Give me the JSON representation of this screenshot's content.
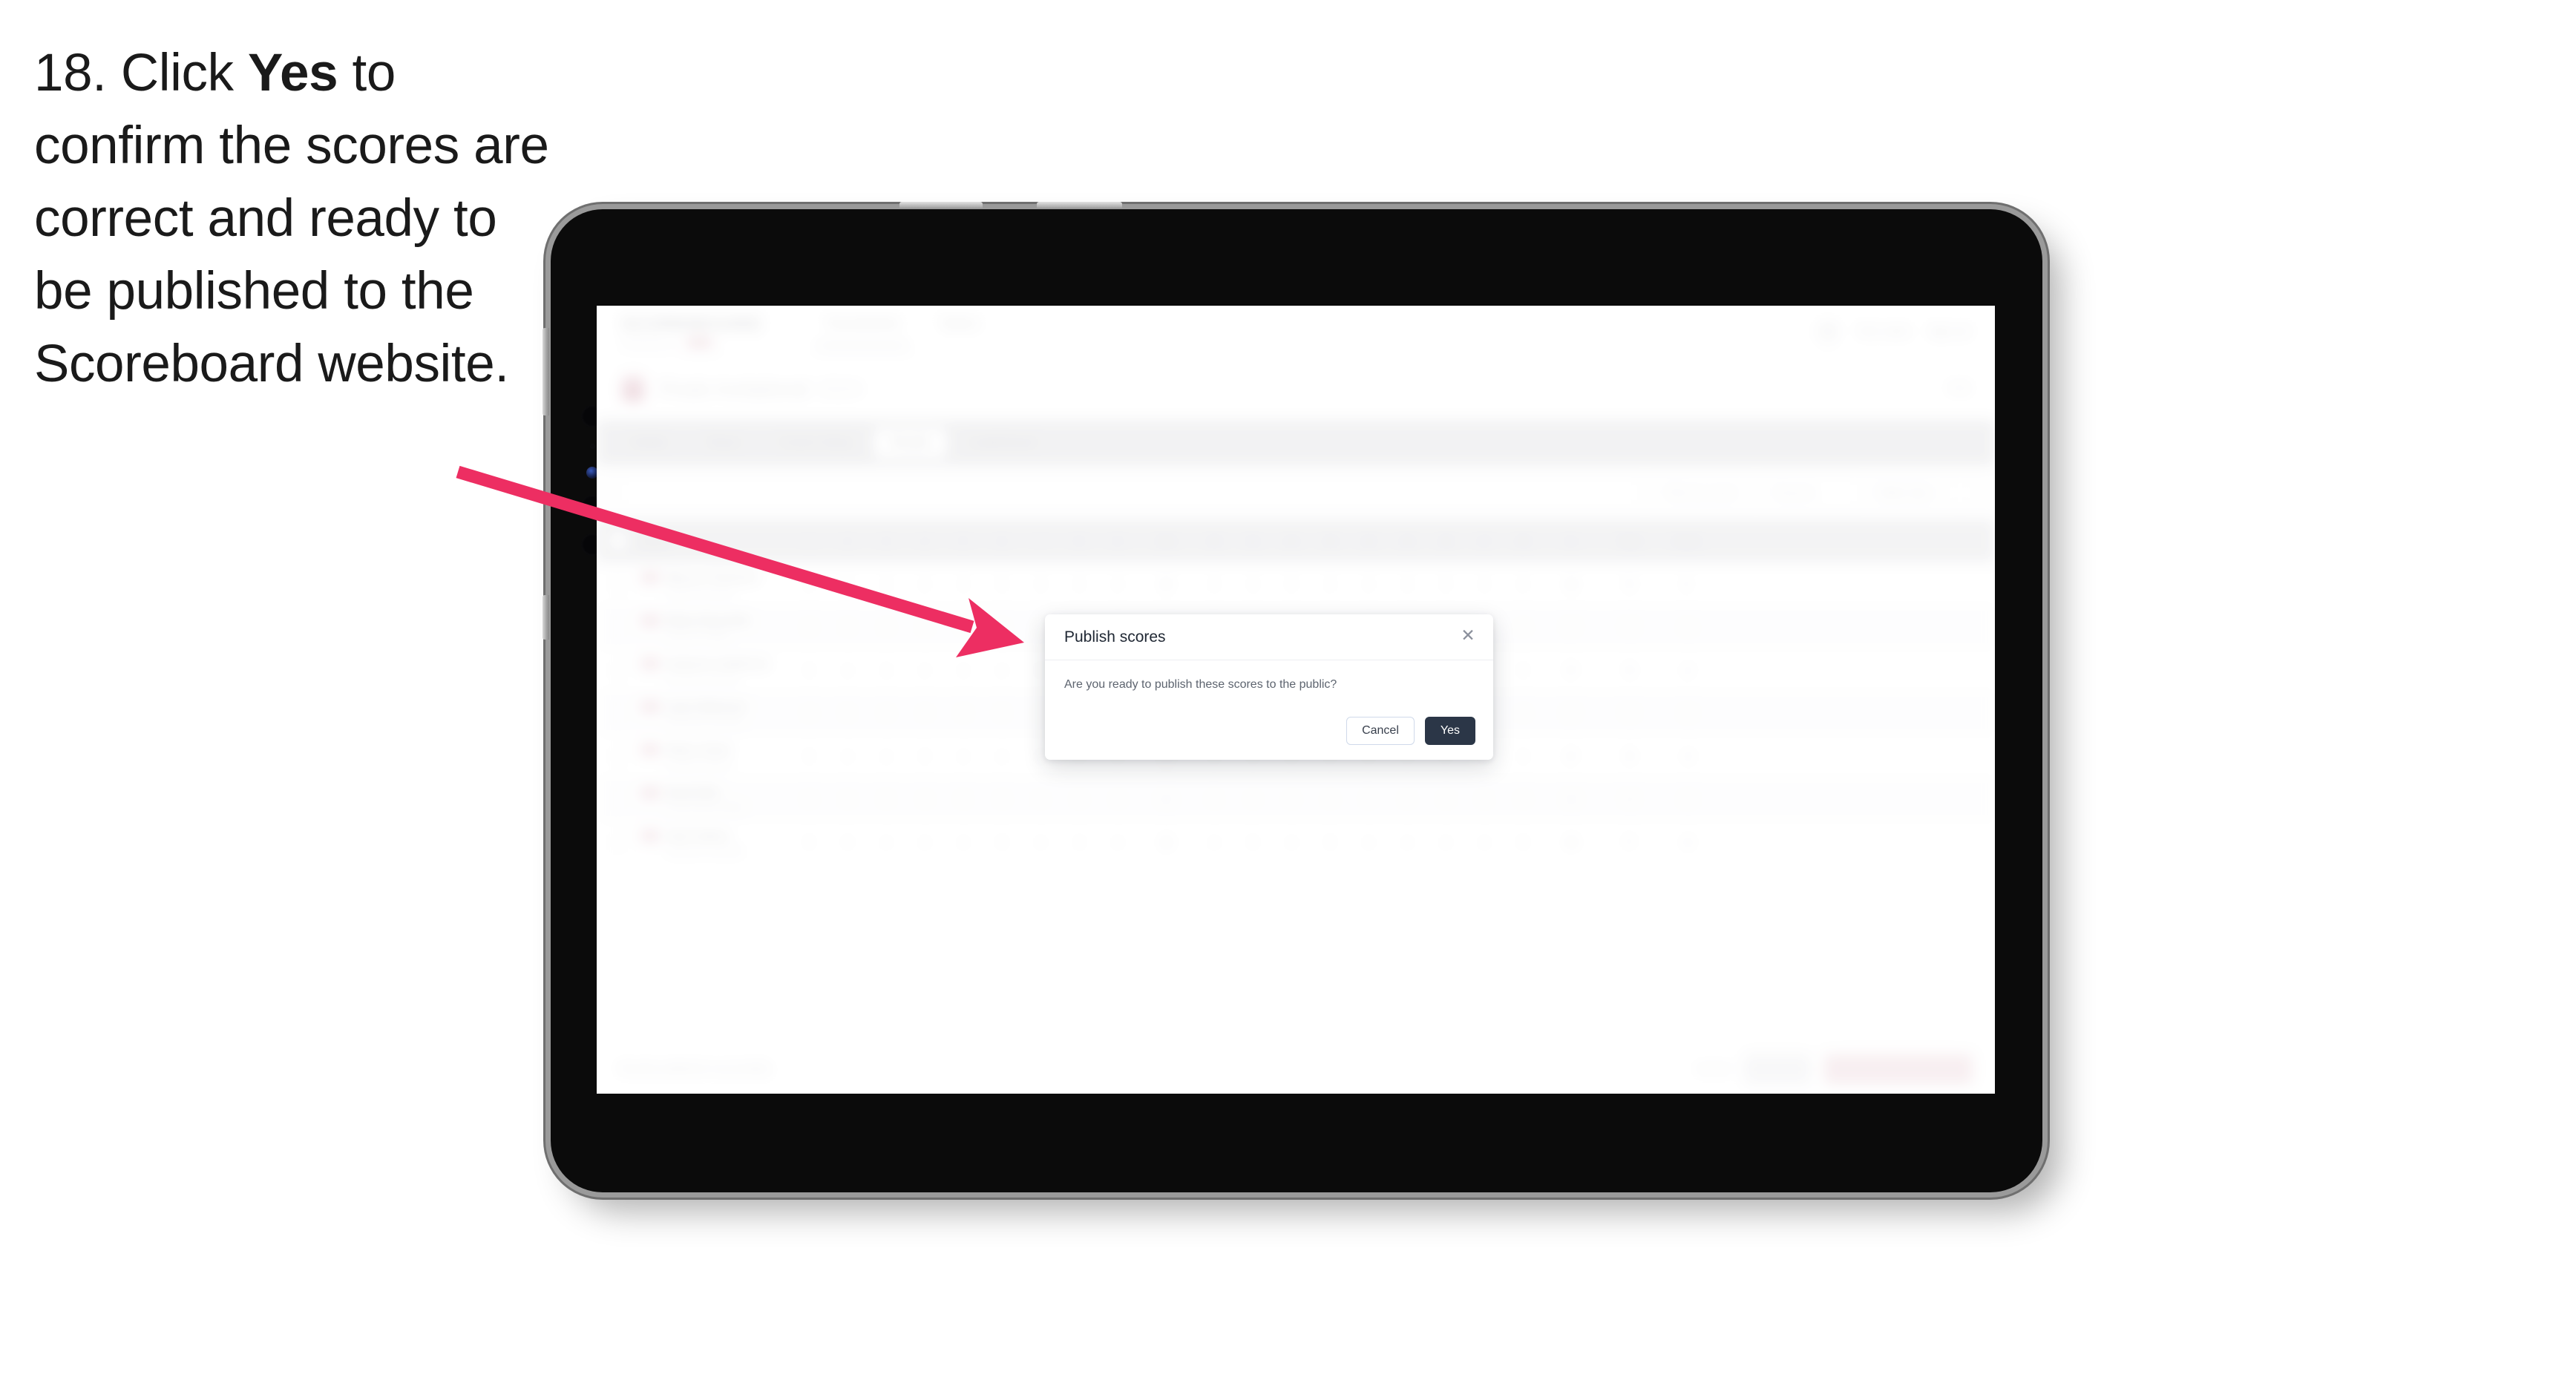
{
  "instruction": {
    "number": "18.",
    "before_bold": "Click ",
    "bold": "Yes",
    "after_bold": " to confirm the scores are correct and ready to be published to the Scoreboard website."
  },
  "annotation": {
    "arrow_color": "#ED2E62",
    "points_to": "yes-button"
  },
  "app": {
    "nav": {
      "logo": "SCOREBOARD",
      "logo_sub": "POWERED BY",
      "logo_badge": "BETA",
      "links": [
        {
          "label": "Tournaments",
          "active": true
        },
        {
          "label": "Teams",
          "active": false
        }
      ],
      "right": [
        {
          "label": "Tom Lewis"
        },
        {
          "label": "Sign out"
        }
      ]
    },
    "tournament": {
      "title": "Finals Invitational",
      "subtitle": "2024",
      "right_label": "Edit"
    },
    "tabs": [
      {
        "label": "Details",
        "selected": false
      },
      {
        "label": "Teams",
        "selected": false
      },
      {
        "label": "Course Setup",
        "selected": false
      },
      {
        "label": "Results",
        "selected": true
      },
      {
        "label": "Leaderboard",
        "selected": false
      }
    ],
    "toolbar": {
      "search_placeholder": "Search players",
      "filters": [
        {
          "label": "Filter by round"
        },
        {
          "label": "Round 1"
        },
        {
          "label": "Table view"
        }
      ]
    },
    "table": {
      "headers": [
        "Player",
        "1",
        "2",
        "3",
        "4",
        "5",
        "6",
        "7",
        "8",
        "9",
        "Out",
        "10",
        "11",
        "12",
        "13",
        "14",
        "15",
        "16",
        "17",
        "18",
        "In",
        "Total",
        "Score"
      ],
      "rows": [
        {
          "name": "Marcus Thomson",
          "sub": "Highland Academy",
          "scores": [
            "4",
            "5",
            "3",
            "4",
            "4",
            "5",
            "3",
            "4",
            "4",
            "36",
            "4",
            "3",
            "5",
            "4",
            "4",
            "3",
            "5",
            "4",
            "4",
            "36",
            "72",
            "E"
          ]
        },
        {
          "name": "Ethan Reynolds",
          "sub": "Oakmont College",
          "scores": [
            "4",
            "4",
            "4",
            "3",
            "5",
            "4",
            "4",
            "5",
            "3",
            "36",
            "5",
            "4",
            "4",
            "4",
            "3",
            "4",
            "4",
            "5",
            "4",
            "37",
            "73",
            "+1"
          ]
        },
        {
          "name": "Cameron Anderson",
          "sub": "Riverside University",
          "scores": [
            "5",
            "4",
            "3",
            "4",
            "4",
            "4",
            "5",
            "4",
            "4",
            "37",
            "4",
            "4",
            "4",
            "5",
            "3",
            "4",
            "4",
            "4",
            "5",
            "37",
            "74",
            "+2"
          ]
        },
        {
          "name": "Liam Patterson",
          "sub": "Northwood University",
          "scores": [
            "4",
            "5",
            "4",
            "4",
            "3",
            "5",
            "4",
            "4",
            "4",
            "37",
            "4",
            "5",
            "4",
            "3",
            "4",
            "5",
            "4",
            "4",
            "4",
            "37",
            "74",
            "+2"
          ]
        },
        {
          "name": "Oliver Grant",
          "sub": "Westfield Athletics",
          "scores": [
            "5",
            "4",
            "4",
            "5",
            "4",
            "4",
            "3",
            "4",
            "5",
            "38",
            "4",
            "4",
            "5",
            "4",
            "4",
            "4",
            "4",
            "5",
            "3",
            "37",
            "75",
            "+3"
          ]
        },
        {
          "name": "Noah Ellis",
          "sub": "Summit State College",
          "scores": [
            "4",
            "4",
            "5",
            "4",
            "5",
            "4",
            "4",
            "4",
            "4",
            "38",
            "5",
            "4",
            "4",
            "4",
            "5",
            "4",
            "3",
            "5",
            "4",
            "38",
            "76",
            "+4"
          ]
        },
        {
          "name": "Jack Sutton",
          "sub": "Lakeshore University",
          "scores": [
            "5",
            "5",
            "4",
            "4",
            "4",
            "5",
            "4",
            "3",
            "4",
            "38",
            "4",
            "5",
            "4",
            "5",
            "4",
            "4",
            "4",
            "4",
            "5",
            "39",
            "77",
            "+5"
          ]
        }
      ]
    },
    "footer": {
      "note": "Results published successfully",
      "link": "Cancel",
      "secondary_button": "Save all",
      "primary_button": "Publish scores to public"
    }
  },
  "modal": {
    "title": "Publish scores",
    "body": "Are you ready to publish these scores to the public?",
    "close_icon": "close-icon",
    "cancel_label": "Cancel",
    "confirm_label": "Yes",
    "confirm_bg": "#2B3647"
  }
}
